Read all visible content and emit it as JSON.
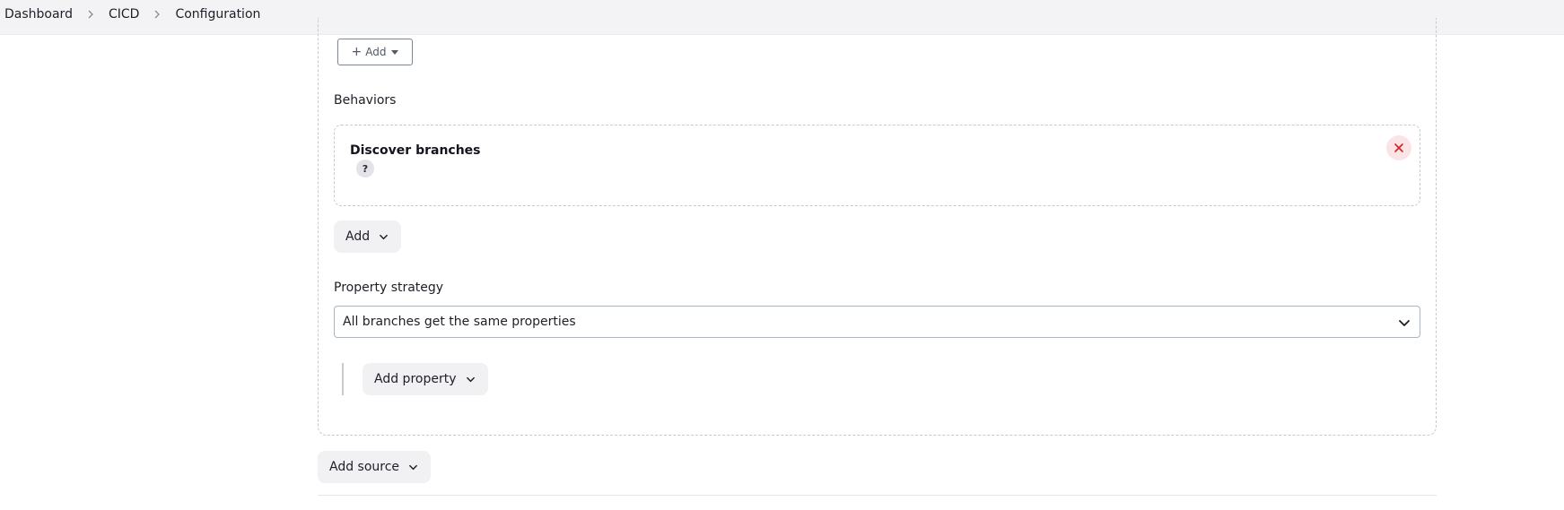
{
  "breadcrumb": {
    "items": [
      {
        "label": "Dashboard"
      },
      {
        "label": "CICD"
      },
      {
        "label": "Configuration"
      }
    ]
  },
  "source": {
    "add_button_label": "Add",
    "behaviors_label": "Behaviors",
    "behavior_item": {
      "title": "Discover branches",
      "help_label": "?"
    },
    "add_behavior_label": "Add",
    "property_strategy_label": "Property strategy",
    "property_strategy_value": "All branches get the same properties",
    "add_property_label": "Add property"
  },
  "add_source_label": "Add source",
  "colors": {
    "remove_icon": "#d2232a",
    "remove_bg": "#fbe4e6",
    "pill_bg": "#f1f1f4",
    "topbar_bg": "#f3f3f6"
  },
  "icons": {
    "breadcrumb_separator": "chevron-right-icon",
    "remove": "close-icon",
    "dropdown": "chevron-down-icon"
  }
}
